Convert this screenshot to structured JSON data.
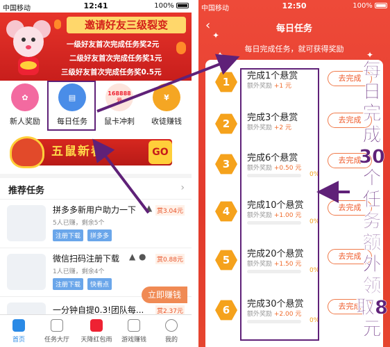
{
  "left": {
    "status": {
      "carrier": "中国移动",
      "time": "12:41",
      "battery": "100%"
    },
    "banner": {
      "title": "邀请好友三级裂变",
      "lines": [
        "一级好友首次完成任务奖2元",
        "二级好友首次完成任务奖1元",
        "三级好友首次完成任务奖0.5元"
      ]
    },
    "quick": [
      {
        "label": "新人奖励",
        "color": "#f36aa0"
      },
      {
        "label": "每日任务",
        "color": "#4a8de8"
      },
      {
        "label": "鼠卡冲刺",
        "color": "#f05a3a",
        "badge": "168888元"
      },
      {
        "label": "收徒赚钱",
        "color": "#f5a623"
      }
    ],
    "promo": {
      "text": "五鼠新春",
      "go": "GO"
    },
    "rec_title": "推荐任务",
    "tasks": [
      {
        "name": "拼多多新用户助力一下",
        "price": "赏3.04元",
        "sub": "5人已赚，剩余5个",
        "tags": [
          "注册下载",
          "拼多多"
        ]
      },
      {
        "name": "微信扫码注册下载",
        "price": "赏0.88元",
        "sub": "1人已赚，剩余4个",
        "tags": [
          "注册下载",
          "快看点"
        ]
      },
      {
        "name": "一分钟自提0.3!团队每...",
        "price": "赏2.37元",
        "sub": "",
        "tags": []
      }
    ],
    "earn_btn": "立即赚钱",
    "tabs": [
      "首页",
      "任务大厅",
      "天降红包雨",
      "游戏赚钱",
      "我的"
    ]
  },
  "right": {
    "status": {
      "carrier": "中国移动",
      "time": "12:50",
      "battery": "100%"
    },
    "title": "每日任务",
    "hint": "每日完成任务，就可获得奖励",
    "extra_label": "额外奖励",
    "go_label": "去完成",
    "rows": [
      {
        "num": "1",
        "title": "完成1个悬赏",
        "reward": "+1 元",
        "pct": ""
      },
      {
        "num": "2",
        "title": "完成3个悬赏",
        "reward": "+2 元",
        "pct": ""
      },
      {
        "num": "3",
        "title": "完成6个悬赏",
        "reward": "+0.50 元",
        "pct": "0%"
      },
      {
        "num": "4",
        "title": "完成10个悬赏",
        "reward": "+1.00 元",
        "pct": "0%"
      },
      {
        "num": "5",
        "title": "完成20个悬赏",
        "reward": "+1.50 元",
        "pct": "0%"
      },
      {
        "num": "6",
        "title": "完成30个悬赏",
        "reward": "+2.00 元",
        "pct": "0%"
      }
    ],
    "annotation": "每日完成30个任务额外领取8元"
  },
  "colors": {
    "annot": "#5f2178",
    "brand_red": "#e23a2c",
    "hex": "#f5a21c"
  }
}
